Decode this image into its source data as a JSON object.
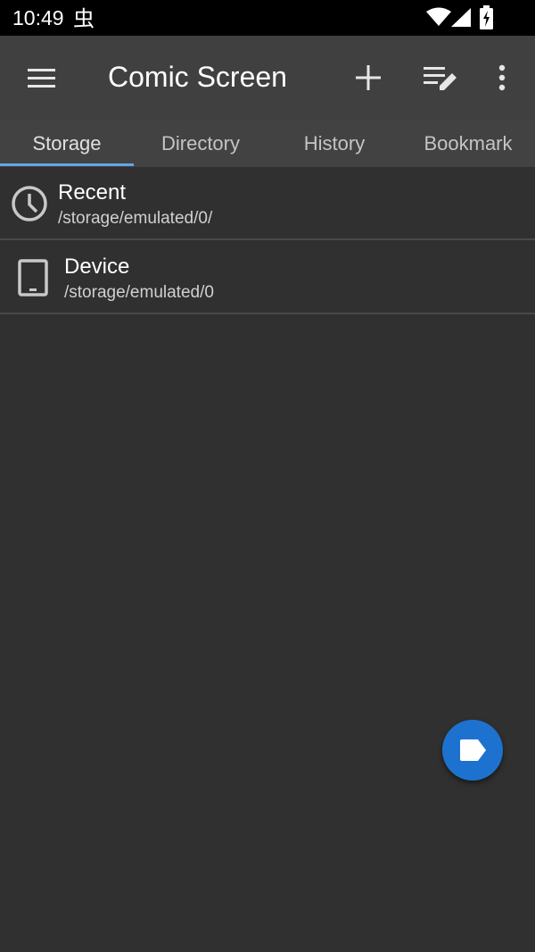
{
  "status_bar": {
    "time": "10:49",
    "icons": [
      "bug-icon",
      "wifi-icon",
      "cell-signal-icon",
      "battery-charging-icon"
    ]
  },
  "app_bar": {
    "title": "Comic Screen",
    "actions": [
      "menu-icon",
      "add-icon",
      "edit-list-icon",
      "more-vert-icon"
    ]
  },
  "tabs": [
    {
      "label": "Storage",
      "active": true
    },
    {
      "label": "Directory",
      "active": false
    },
    {
      "label": "History",
      "active": false
    },
    {
      "label": "Bookmark",
      "active": false
    }
  ],
  "storage_items": [
    {
      "name": "Recent",
      "path": "/storage/emulated/0/",
      "icon": "clock-icon"
    },
    {
      "name": "Device",
      "path": "/storage/emulated/0",
      "icon": "tablet-icon"
    }
  ],
  "fab": {
    "icon": "label-icon"
  },
  "colors": {
    "background": "#303030",
    "app_bar": "#404040",
    "tab_bar": "#424242",
    "tab_indicator": "#64a5e6",
    "fab": "#1e72cf"
  }
}
